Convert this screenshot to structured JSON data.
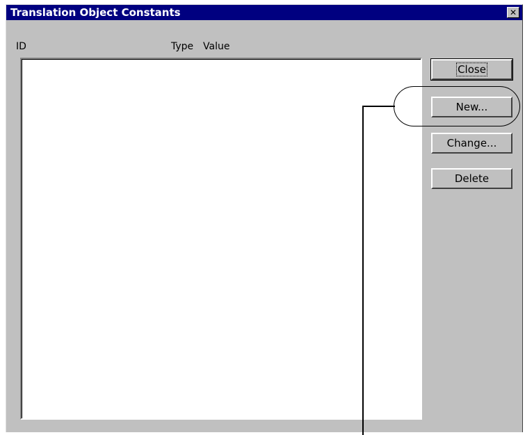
{
  "window": {
    "title": "Translation Object Constants",
    "close_glyph": "✕"
  },
  "list": {
    "columns": [
      "ID",
      "Type",
      "Value"
    ]
  },
  "buttons": {
    "close": "Close",
    "new": "New...",
    "change": "Change...",
    "delete": "Delete"
  },
  "colors": {
    "titlebar": "#000080",
    "dialog_face": "#c0c0c0",
    "list_background": "#ffffff"
  }
}
